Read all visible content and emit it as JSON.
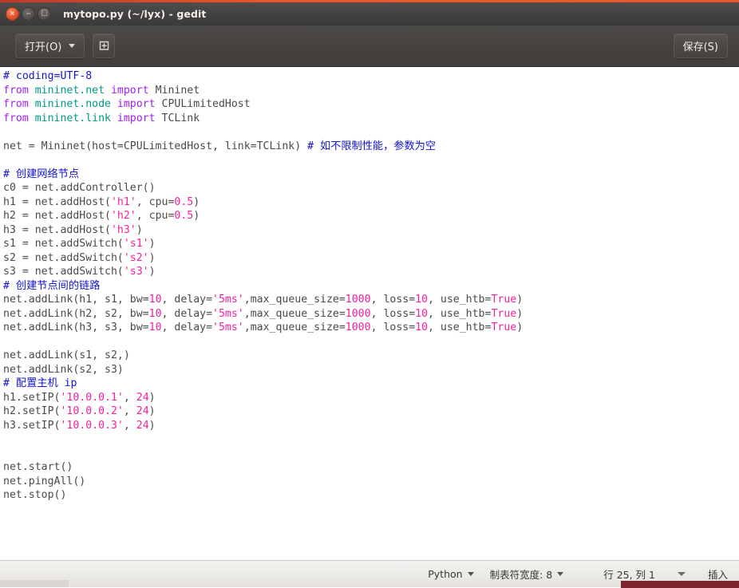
{
  "window": {
    "title": "mytopo.py (~/lyx) - gedit",
    "buttons": {
      "close": "close-button",
      "minimize": "minimize-button",
      "maximize": "maximize-button"
    },
    "close_glyph": "✕",
    "minimize_glyph": "−",
    "maximize_glyph": "□"
  },
  "toolbar": {
    "open_label": "打开(O)",
    "new_tab_icon": "new-document-icon",
    "save_label": "保存(S)"
  },
  "editor": {
    "lines": [
      [
        {
          "t": "# coding=UTF-8",
          "c": "cm"
        }
      ],
      [
        {
          "t": "from ",
          "c": "kw"
        },
        {
          "t": "mininet.net ",
          "c": "mod"
        },
        {
          "t": "import ",
          "c": "kw"
        },
        {
          "t": "Mininet",
          "c": "pl"
        }
      ],
      [
        {
          "t": "from ",
          "c": "kw"
        },
        {
          "t": "mininet.node ",
          "c": "mod"
        },
        {
          "t": "import ",
          "c": "kw"
        },
        {
          "t": "CPULimitedHost",
          "c": "pl"
        }
      ],
      [
        {
          "t": "from ",
          "c": "kw"
        },
        {
          "t": "mininet.link ",
          "c": "mod"
        },
        {
          "t": "import ",
          "c": "kw"
        },
        {
          "t": "TCLink",
          "c": "pl"
        }
      ],
      [
        {
          "t": "",
          "c": "pl"
        }
      ],
      [
        {
          "t": "net = Mininet(host=CPULimitedHost, link=TCLink) ",
          "c": "pl"
        },
        {
          "t": "# 如不限制性能，参数为空",
          "c": "cm"
        }
      ],
      [
        {
          "t": "",
          "c": "pl"
        }
      ],
      [
        {
          "t": "# 创建网络节点",
          "c": "cm"
        }
      ],
      [
        {
          "t": "c0 = net.addController()",
          "c": "pl"
        }
      ],
      [
        {
          "t": "h1 = net.addHost(",
          "c": "pl"
        },
        {
          "t": "'h1'",
          "c": "st"
        },
        {
          "t": ", cpu=",
          "c": "pl"
        },
        {
          "t": "0.5",
          "c": "nm"
        },
        {
          "t": ")",
          "c": "pl"
        }
      ],
      [
        {
          "t": "h2 = net.addHost(",
          "c": "pl"
        },
        {
          "t": "'h2'",
          "c": "st"
        },
        {
          "t": ", cpu=",
          "c": "pl"
        },
        {
          "t": "0.5",
          "c": "nm"
        },
        {
          "t": ")",
          "c": "pl"
        }
      ],
      [
        {
          "t": "h3 = net.addHost(",
          "c": "pl"
        },
        {
          "t": "'h3'",
          "c": "st"
        },
        {
          "t": ")",
          "c": "pl"
        }
      ],
      [
        {
          "t": "s1 = net.addSwitch(",
          "c": "pl"
        },
        {
          "t": "'s1'",
          "c": "st"
        },
        {
          "t": ")",
          "c": "pl"
        }
      ],
      [
        {
          "t": "s2 = net.addSwitch(",
          "c": "pl"
        },
        {
          "t": "'s2'",
          "c": "st"
        },
        {
          "t": ")",
          "c": "pl"
        }
      ],
      [
        {
          "t": "s3 = net.addSwitch(",
          "c": "pl"
        },
        {
          "t": "'s3'",
          "c": "st"
        },
        {
          "t": ")",
          "c": "pl"
        }
      ],
      [
        {
          "t": "# 创建节点间的链路",
          "c": "cm"
        }
      ],
      [
        {
          "t": "net.addLink(h1, s1, bw=",
          "c": "pl"
        },
        {
          "t": "10",
          "c": "nm"
        },
        {
          "t": ", delay=",
          "c": "pl"
        },
        {
          "t": "'5ms'",
          "c": "st"
        },
        {
          "t": ",max_queue_size=",
          "c": "pl"
        },
        {
          "t": "1000",
          "c": "nm"
        },
        {
          "t": ", loss=",
          "c": "pl"
        },
        {
          "t": "10",
          "c": "nm"
        },
        {
          "t": ", use_htb=",
          "c": "pl"
        },
        {
          "t": "True",
          "c": "bi"
        },
        {
          "t": ")",
          "c": "pl"
        }
      ],
      [
        {
          "t": "net.addLink(h2, s2, bw=",
          "c": "pl"
        },
        {
          "t": "10",
          "c": "nm"
        },
        {
          "t": ", delay=",
          "c": "pl"
        },
        {
          "t": "'5ms'",
          "c": "st"
        },
        {
          "t": ",max_queue_size=",
          "c": "pl"
        },
        {
          "t": "1000",
          "c": "nm"
        },
        {
          "t": ", loss=",
          "c": "pl"
        },
        {
          "t": "10",
          "c": "nm"
        },
        {
          "t": ", use_htb=",
          "c": "pl"
        },
        {
          "t": "True",
          "c": "bi"
        },
        {
          "t": ")",
          "c": "pl"
        }
      ],
      [
        {
          "t": "net.addLink(h3, s3, bw=",
          "c": "pl"
        },
        {
          "t": "10",
          "c": "nm"
        },
        {
          "t": ", delay=",
          "c": "pl"
        },
        {
          "t": "'5ms'",
          "c": "st"
        },
        {
          "t": ",max_queue_size=",
          "c": "pl"
        },
        {
          "t": "1000",
          "c": "nm"
        },
        {
          "t": ", loss=",
          "c": "pl"
        },
        {
          "t": "10",
          "c": "nm"
        },
        {
          "t": ", use_htb=",
          "c": "pl"
        },
        {
          "t": "True",
          "c": "bi"
        },
        {
          "t": ")",
          "c": "pl"
        }
      ],
      [
        {
          "t": "",
          "c": "pl"
        }
      ],
      [
        {
          "t": "net.addLink(s1, s2,)",
          "c": "pl"
        }
      ],
      [
        {
          "t": "net.addLink(s2, s3)",
          "c": "pl"
        }
      ],
      [
        {
          "t": "# 配置主机 ip",
          "c": "cm"
        }
      ],
      [
        {
          "t": "h1.setIP(",
          "c": "pl"
        },
        {
          "t": "'10.0.0.1'",
          "c": "st"
        },
        {
          "t": ", ",
          "c": "pl"
        },
        {
          "t": "24",
          "c": "nm"
        },
        {
          "t": ")",
          "c": "pl"
        }
      ],
      [
        {
          "t": "h2.setIP(",
          "c": "pl"
        },
        {
          "t": "'10.0.0.2'",
          "c": "st"
        },
        {
          "t": ", ",
          "c": "pl"
        },
        {
          "t": "24",
          "c": "nm"
        },
        {
          "t": ")",
          "c": "pl"
        }
      ],
      [
        {
          "t": "h3.setIP(",
          "c": "pl"
        },
        {
          "t": "'10.0.0.3'",
          "c": "st"
        },
        {
          "t": ", ",
          "c": "pl"
        },
        {
          "t": "24",
          "c": "nm"
        },
        {
          "t": ")",
          "c": "pl"
        }
      ],
      [
        {
          "t": "",
          "c": "pl"
        }
      ],
      [
        {
          "t": "",
          "c": "pl"
        }
      ],
      [
        {
          "t": "net.start()",
          "c": "pl"
        }
      ],
      [
        {
          "t": "net.pingAll()",
          "c": "pl"
        }
      ],
      [
        {
          "t": "net.stop()",
          "c": "pl"
        }
      ]
    ]
  },
  "statusbar": {
    "language": "Python",
    "tab_width_label": "制表符宽度: 8",
    "position": "行 25, 列 1",
    "insert_mode": "插入"
  },
  "colors": {
    "accent": "#e8552a",
    "comment": "#1414cf",
    "keyword": "#a020f0",
    "module": "#009b86",
    "string": "#f41fa0",
    "number": "#f41fa0",
    "plain": "#4a4a48",
    "titlebar": "#454241",
    "bottom_strip": "#7c2430"
  }
}
